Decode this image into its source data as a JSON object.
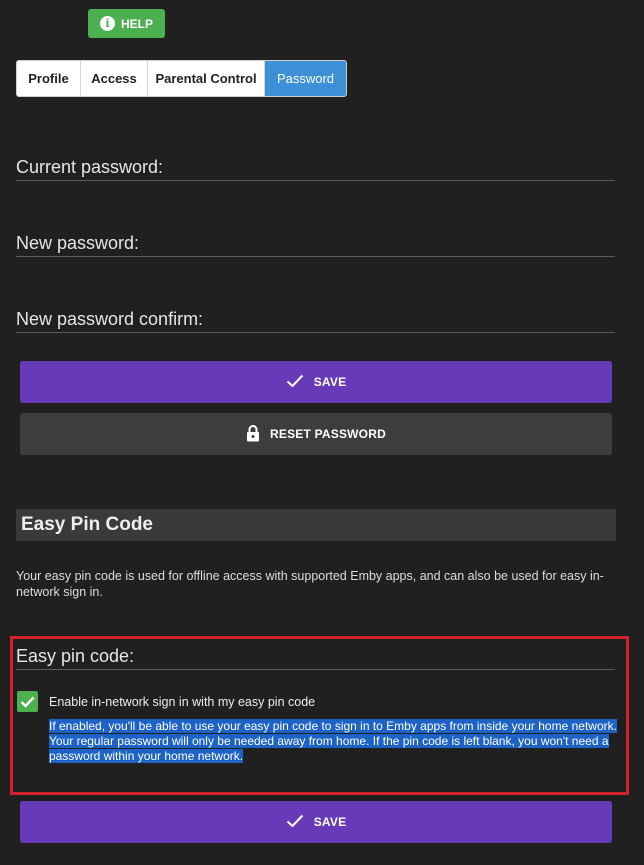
{
  "help_button": {
    "label": "HELP",
    "icon": "info-icon"
  },
  "tabs": [
    {
      "label": "Profile",
      "active": false
    },
    {
      "label": "Access",
      "active": false
    },
    {
      "label": "Parental Control",
      "active": false
    },
    {
      "label": "Password",
      "active": true
    }
  ],
  "password_form": {
    "current_label": "Current password:",
    "new_label": "New password:",
    "confirm_label": "New password confirm:",
    "save_label": "SAVE",
    "reset_label": "RESET PASSWORD"
  },
  "easy_pin": {
    "heading": "Easy Pin Code",
    "description": "Your easy pin code is used for offline access with supported Emby apps, and can also be used for easy in-network sign in.",
    "field_label": "Easy pin code:",
    "checkbox_label": "Enable in-network sign in with my easy pin code",
    "checkbox_checked": true,
    "checkbox_help": "If enabled, you'll be able to use your easy pin code to sign in to Emby apps from inside your home network. Your regular password will only be needed away from home. If the pin code is left blank, you won't need a password within your home network.",
    "save_label": "SAVE"
  },
  "colors": {
    "background": "#202020",
    "accent_purple": "#673ab7",
    "active_tab": "#3d8fd6",
    "help_green": "#4caf50",
    "annotation_red": "#d2232a"
  }
}
